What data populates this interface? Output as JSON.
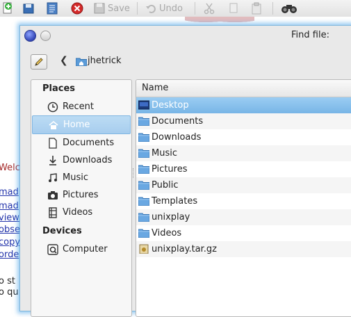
{
  "background_app": {
    "toolbar": {
      "save_label": "Save",
      "undo_label": "Undo"
    },
    "side_text": [
      {
        "text": "Welco",
        "style": "red"
      },
      {
        "text": "mad",
        "style": "link"
      },
      {
        "text": "mad",
        "style": "link"
      },
      {
        "text": "view",
        "style": "link"
      },
      {
        "text": "obse",
        "style": "link"
      },
      {
        "text": "copy",
        "style": "link"
      },
      {
        "text": "orde",
        "style": "link"
      },
      {
        "text": "o st",
        "style": "plain"
      },
      {
        "text": "o qu",
        "style": "plain"
      }
    ]
  },
  "dialog": {
    "title": "Find file:",
    "breadcrumb": {
      "folder": "jhetrick"
    },
    "places": {
      "heading": "Places",
      "items": [
        {
          "label": "Recent",
          "icon": "clock-icon"
        },
        {
          "label": "Home",
          "icon": "home-icon",
          "selected": true
        },
        {
          "label": "Documents",
          "icon": "document-icon"
        },
        {
          "label": "Downloads",
          "icon": "download-icon"
        },
        {
          "label": "Music",
          "icon": "music-icon"
        },
        {
          "label": "Pictures",
          "icon": "camera-icon"
        },
        {
          "label": "Videos",
          "icon": "film-icon"
        }
      ],
      "devices_heading": "Devices",
      "devices": [
        {
          "label": "Computer",
          "icon": "computer-icon"
        }
      ]
    },
    "filelist": {
      "column_name": "Name",
      "rows": [
        {
          "name": "Desktop",
          "type": "desktop-folder",
          "selected": true
        },
        {
          "name": "Documents",
          "type": "folder"
        },
        {
          "name": "Downloads",
          "type": "folder"
        },
        {
          "name": "Music",
          "type": "folder"
        },
        {
          "name": "Pictures",
          "type": "folder"
        },
        {
          "name": "Public",
          "type": "folder"
        },
        {
          "name": "Templates",
          "type": "folder"
        },
        {
          "name": "unixplay",
          "type": "folder"
        },
        {
          "name": "Videos",
          "type": "folder"
        },
        {
          "name": "unixplay.tar.gz",
          "type": "archive"
        }
      ]
    }
  },
  "colors": {
    "selection": "#78b5e6",
    "places_selection": "#a7cdee",
    "folder": "#5b9bd8",
    "focus_glow": "#46a0e6"
  }
}
